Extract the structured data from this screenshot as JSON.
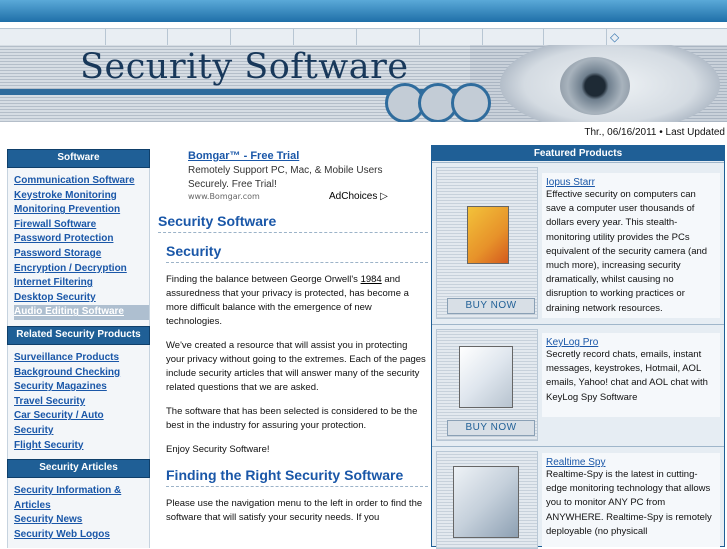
{
  "header": {
    "site_title": "Security Software",
    "date_line": "Thr., 06/16/2011 • Last Updated",
    "nav_icon": "diamond-icon"
  },
  "sidebar": {
    "sections": [
      {
        "title": "Software",
        "links": [
          "Communication Software",
          "Keystroke Monitoring",
          "Monitoring Prevention",
          "Firewall Software",
          "Password Protection",
          "Password Storage",
          "Encryption / Decryption",
          "Internet Filtering",
          "Desktop Security",
          "Audio Editing Software"
        ]
      },
      {
        "title": "Related Security Products",
        "links": [
          "Surveillance Products",
          "Background Checking",
          "Security Magazines",
          "Travel Security",
          "Car Security / Auto",
          "Security",
          "Flight Security"
        ]
      },
      {
        "title": "Security Articles",
        "links": [
          "Security Information &",
          "Articles",
          "Security News",
          "Security Web Logos"
        ]
      }
    ]
  },
  "ad": {
    "title": "Bomgar™ - Free Trial",
    "text1": "Remotely Support PC, Mac, & Mobile Users",
    "text2": "Securely. Free Trial!",
    "url": "www.Bomgar.com",
    "adchoices": "AdChoices ▷"
  },
  "main": {
    "heading": "Security Software",
    "sub1": "Security",
    "p1_pre": "Finding the balance between George Orwell's ",
    "p1_link": "1984",
    "p1_post": " and assuredness that your privacy is protected, has become a more difficult balance with the emergence of new technologies.",
    "p2": "We've created a resource that will assist you in protecting your privacy without going to the extremes. Each of the pages include security articles that will answer many of the security related questions that we are asked.",
    "p3": "The software that has been selected is considered to be the best in the industry for assuring your protection.",
    "p4": "Enjoy Security Software!",
    "sub2": "Finding the Right Security Software",
    "p5": "Please use the navigation menu to the left in order to find the software that will satisfy your security needs. If you"
  },
  "featured": {
    "title": "Featured Products",
    "buy_label": "BUY NOW",
    "products": [
      {
        "name": "Iopus Starr",
        "desc": "Effective security on computers can save a computer user thousands of dollars every year. This stealth-monitoring utility provides the PCs equivalent of the security camera (and much more), increasing security dramatically, whilst causing no disruption to working practices or draining network resources."
      },
      {
        "name": "KeyLog Pro",
        "desc": "Secretly record chats, emails, instant messages, keystrokes, Hotmail, AOL emails, Yahoo! chat and AOL chat with KeyLog Spy Software"
      },
      {
        "name": "Realtime Spy",
        "desc": "Realtime-Spy is the latest in cutting-edge monitoring technology that allows you to monitor ANY PC from ANYWHERE. Realtime-Spy is remotely deployable (no physicall"
      }
    ]
  }
}
